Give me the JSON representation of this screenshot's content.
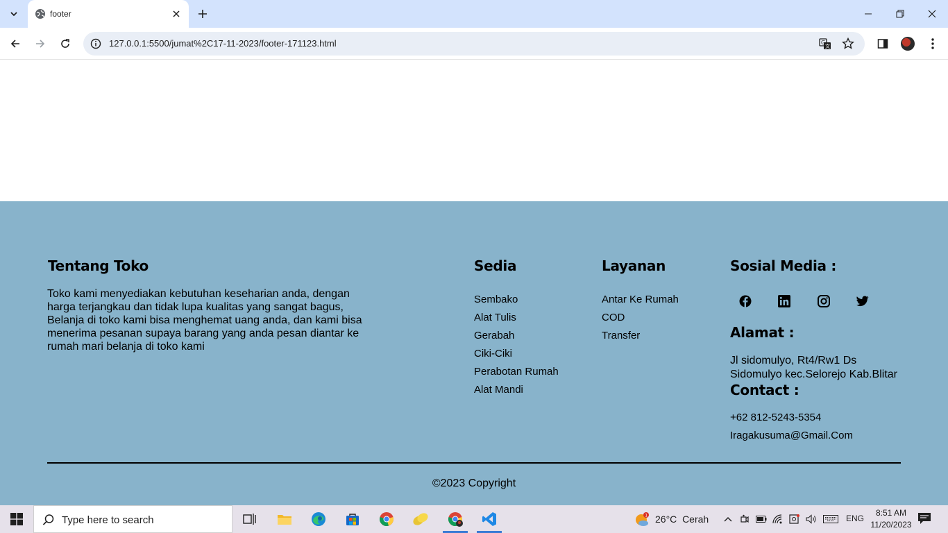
{
  "browser": {
    "tab_title": "footer",
    "url": "127.0.0.1:5500/jumat%2C17-11-2023/footer-171123.html"
  },
  "footer": {
    "about": {
      "heading": "Tentang Toko",
      "text": "Toko kami menyediakan kebutuhan keseharian anda, dengan harga terjangkau dan tidak lupa kualitas yang sangat bagus, Belanja di toko kami bisa menghemat uang anda, dan kami bisa menerima pesanan supaya barang yang anda pesan diantar ke rumah mari belanja di toko kami"
    },
    "sedia": {
      "heading": "Sedia",
      "items": [
        "Sembako",
        "Alat Tulis",
        "Gerabah",
        "Ciki-Ciki",
        "Perabotan Rumah",
        "Alat Mandi"
      ]
    },
    "layanan": {
      "heading": "Layanan",
      "items": [
        "Antar Ke Rumah",
        "COD",
        "Transfer"
      ]
    },
    "social": {
      "heading": "Sosial Media :",
      "icons": [
        "facebook-icon",
        "linkedin-icon",
        "instagram-icon",
        "twitter-icon"
      ]
    },
    "alamat": {
      "heading": "Alamat :",
      "text": "Jl sidomulyo, Rt4/Rw1 Ds Sidomulyo kec.Selorejo Kab.Blitar"
    },
    "contact": {
      "heading": "Contact :",
      "phone": "+62 812-5243-5354",
      "email": "Iragakusuma@Gmail.Com"
    },
    "copyright": "©2023 Copyright",
    "background_color": "#88b3cb"
  },
  "taskbar": {
    "search_placeholder": "Type here to search",
    "weather_temp": "26°C",
    "weather_desc": "Cerah",
    "weather_badge": "1",
    "language": "ENG",
    "time": "8:51 AM",
    "date": "11/20/2023"
  }
}
